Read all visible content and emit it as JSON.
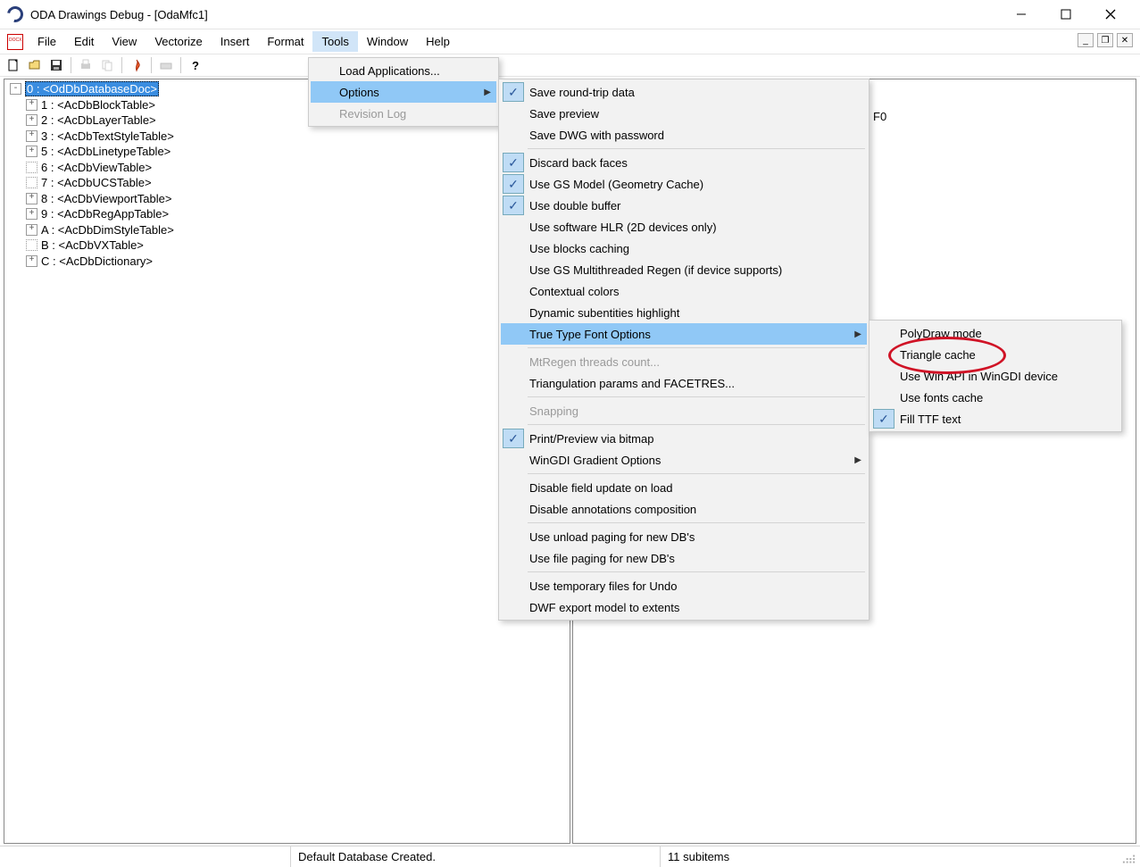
{
  "title": "ODA Drawings Debug - [OdaMfc1]",
  "menubar": [
    "File",
    "Edit",
    "View",
    "Vectorize",
    "Insert",
    "Format",
    "Tools",
    "Window",
    "Help"
  ],
  "activeMenuIndex": 6,
  "tree": [
    {
      "exp": "-",
      "indent": 0,
      "text": "0 : <OdDbDatabaseDoc>",
      "selected": true
    },
    {
      "exp": "+",
      "indent": 1,
      "text": "1 : <AcDbBlockTable>"
    },
    {
      "exp": "+",
      "indent": 1,
      "text": "2 : <AcDbLayerTable>"
    },
    {
      "exp": "+",
      "indent": 1,
      "text": "3 : <AcDbTextStyleTable>"
    },
    {
      "exp": "+",
      "indent": 1,
      "text": "5 : <AcDbLinetypeTable>"
    },
    {
      "exp": "",
      "indent": 1,
      "text": "6 : <AcDbViewTable>",
      "dotted": true
    },
    {
      "exp": "",
      "indent": 1,
      "text": "7 : <AcDbUCSTable>",
      "dotted": true
    },
    {
      "exp": "+",
      "indent": 1,
      "text": "8 : <AcDbViewportTable>"
    },
    {
      "exp": "+",
      "indent": 1,
      "text": "9 : <AcDbRegAppTable>"
    },
    {
      "exp": "+",
      "indent": 1,
      "text": "A : <AcDbDimStyleTable>"
    },
    {
      "exp": "",
      "indent": 1,
      "text": "B : <AcDbVXTable>",
      "dotted": true
    },
    {
      "exp": "+",
      "indent": 1,
      "text": "C : <AcDbDictionary>"
    }
  ],
  "rightText": "F0",
  "status": {
    "left": "",
    "center": "Default Database Created.",
    "right": "11 subitems"
  },
  "toolsMenu": [
    {
      "label": "Load Applications..."
    },
    {
      "label": "Options",
      "highlight": true,
      "arrow": true
    },
    {
      "label": "Revision Log",
      "disabled": true
    }
  ],
  "optionsMenu": [
    {
      "label": "Save round-trip data",
      "checked": true
    },
    {
      "label": "Save preview"
    },
    {
      "label": "Save DWG with password"
    },
    {
      "sep": true
    },
    {
      "label": "Discard back faces",
      "checked": true
    },
    {
      "label": "Use GS Model (Geometry Cache)",
      "checked": true
    },
    {
      "label": "Use double buffer",
      "checked": true
    },
    {
      "label": "Use software HLR (2D devices only)"
    },
    {
      "label": "Use blocks caching"
    },
    {
      "label": "Use GS Multithreaded Regen (if device supports)"
    },
    {
      "label": "Contextual colors"
    },
    {
      "label": "Dynamic subentities highlight"
    },
    {
      "label": "True Type Font Options",
      "highlight": true,
      "arrow": true
    },
    {
      "sep": true
    },
    {
      "label": "MtRegen threads count...",
      "disabled": true
    },
    {
      "label": "Triangulation params and FACETRES..."
    },
    {
      "sep": true
    },
    {
      "label": "Snapping",
      "disabled": true
    },
    {
      "sep": true
    },
    {
      "label": "Print/Preview via bitmap",
      "checked": true
    },
    {
      "label": "WinGDI Gradient Options",
      "arrow": true
    },
    {
      "sep": true
    },
    {
      "label": "Disable field update on load"
    },
    {
      "label": "Disable annotations composition"
    },
    {
      "sep": true
    },
    {
      "label": "Use unload paging for new DB's"
    },
    {
      "label": "Use file paging for new DB's"
    },
    {
      "sep": true
    },
    {
      "label": "Use temporary files for Undo"
    },
    {
      "label": "DWF export model to extents"
    }
  ],
  "ttfMenu": [
    {
      "label": "PolyDraw mode"
    },
    {
      "label": "Triangle cache"
    },
    {
      "label": "Use Win API in WinGDI device"
    },
    {
      "label": "Use fonts cache"
    },
    {
      "label": "Fill TTF text",
      "checked": true
    }
  ]
}
